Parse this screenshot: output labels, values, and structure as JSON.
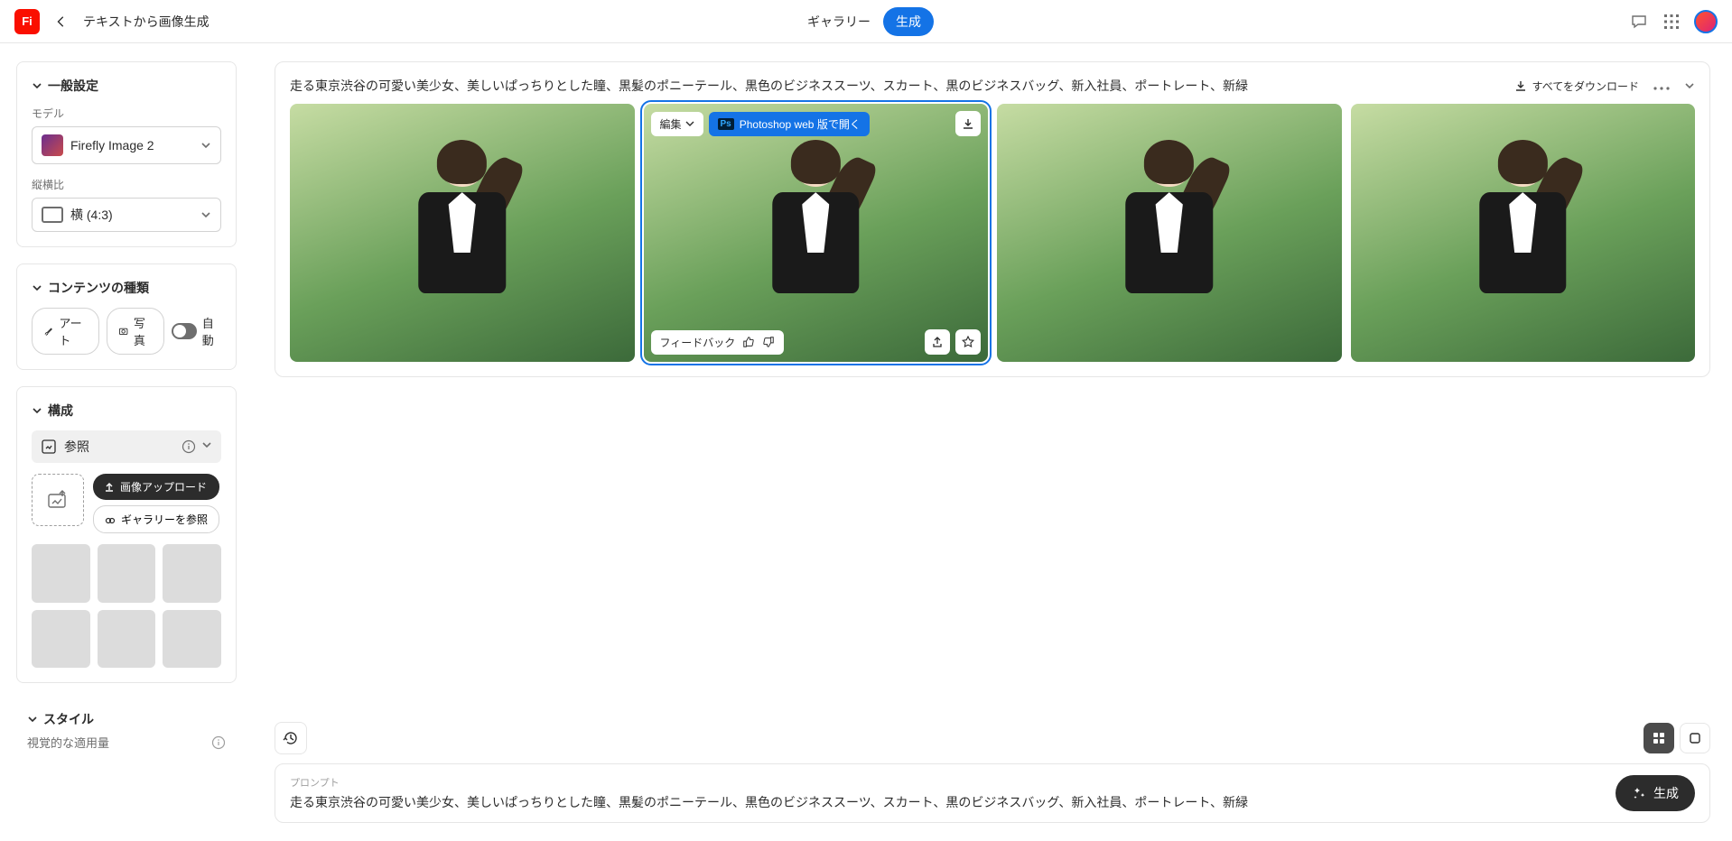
{
  "header": {
    "logo_text": "Fi",
    "title": "テキストから画像生成",
    "gallery": "ギャラリー",
    "generate": "生成"
  },
  "sidebar": {
    "general": {
      "title": "一般設定"
    },
    "model": {
      "label": "モデル",
      "value": "Firefly Image 2"
    },
    "aspect": {
      "label": "縦横比",
      "value": "横 (4:3)"
    },
    "content_type": {
      "title": "コンテンツの種類",
      "art": "アート",
      "photo": "写真",
      "auto": "自動"
    },
    "composition": {
      "title": "構成",
      "reference": "参照",
      "upload": "画像アップロード",
      "browse": "ギャラリーを参照"
    },
    "style": {
      "title": "スタイル"
    },
    "visual": {
      "label": "視覚的な適用量"
    }
  },
  "results": {
    "prompt": "走る東京渋谷の可愛い美少女、美しいぱっちりとした瞳、黒髪のポニーテール、黒色のビジネススーツ、スカート、黒のビジネスバッグ、新入社員、ポートレート、新緑",
    "download_all": "すべてをダウンロード",
    "hover": {
      "edit": "編集",
      "open_ps": "Photoshop web 版で開く",
      "feedback": "フィードバック"
    }
  },
  "prompt_bar": {
    "label": "プロンプト",
    "text": "走る東京渋谷の可愛い美少女、美しいぱっちりとした瞳、黒髪のポニーテール、黒色のビジネススーツ、スカート、黒のビジネスバッグ、新入社員、ポートレート、新緑",
    "generate": "生成"
  }
}
